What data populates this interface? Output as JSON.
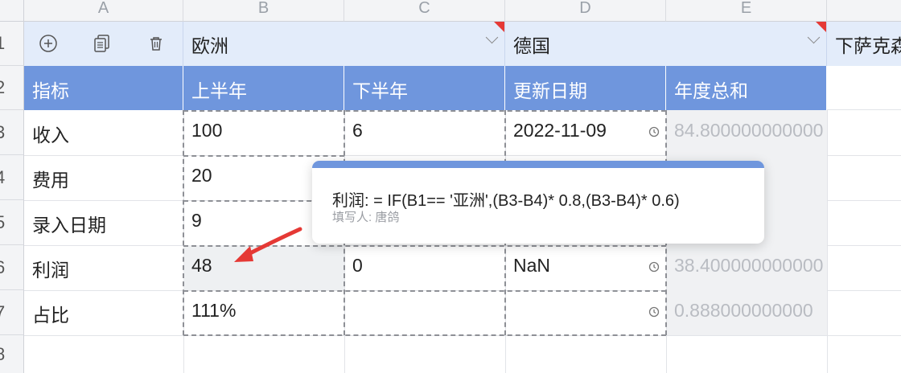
{
  "column_headers": [
    "A",
    "B",
    "C",
    "D",
    "E"
  ],
  "row_headers": [
    "1",
    "2",
    "3",
    "4",
    "5",
    "6",
    "7",
    "8"
  ],
  "row1": {
    "toolbar": {
      "add_icon": "plus-circle-icon",
      "copy_icon": "copy-icon",
      "delete_icon": "trash-icon"
    },
    "region": "欧洲",
    "country": "德国",
    "state": "下萨克森"
  },
  "header_row": [
    "指标",
    "上半年",
    "下半年",
    "更新日期",
    "年度总和"
  ],
  "rows": [
    {
      "label": "收入",
      "b": "100",
      "c": "6",
      "d": "2022-11-09",
      "e": "84.800000000000"
    },
    {
      "label": "费用",
      "b": "20",
      "c": "",
      "d": "",
      "e": ""
    },
    {
      "label": "录入日期",
      "b": "9",
      "c": "",
      "d": "",
      "e": ""
    },
    {
      "label": "利润",
      "b": "48",
      "c": "0",
      "d": "NaN",
      "e": "38.400000000000"
    },
    {
      "label": "占比",
      "b": "111%",
      "c": "",
      "d": "",
      "e": "0.888000000000"
    }
  ],
  "tooltip": {
    "formula": "利润: = IF(B1== '亚洲',(B3-B4)* 0.8,(B3-B4)* 0.6)",
    "author": "填写人: 唐鸽"
  },
  "colors": {
    "header_blue": "#6f96dd",
    "row1_bg": "#e3ecfa",
    "annotation_red": "#e53935"
  }
}
